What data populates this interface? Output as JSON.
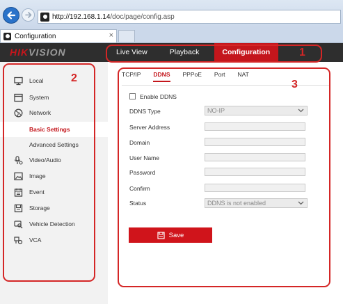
{
  "browser": {
    "url_host": "http://192.168.1.14",
    "url_path": "/doc/page/config.asp",
    "tab_title": "Configuration",
    "tab_close": "×"
  },
  "header": {
    "logo_brand": "HIK",
    "logo_rest": "VISION",
    "nav": [
      {
        "label": "Live View",
        "active": false
      },
      {
        "label": "Playback",
        "active": false
      },
      {
        "label": "Configuration",
        "active": true
      }
    ]
  },
  "sidebar": {
    "items": [
      {
        "label": "Local",
        "icon": "monitor-icon"
      },
      {
        "label": "System",
        "icon": "system-icon"
      },
      {
        "label": "Network",
        "icon": "globe-icon"
      },
      {
        "label": "Basic Settings",
        "sub": true,
        "active": true
      },
      {
        "label": "Advanced Settings",
        "sub": true
      },
      {
        "label": "Video/Audio",
        "icon": "microphone-icon"
      },
      {
        "label": "Image",
        "icon": "image-icon"
      },
      {
        "label": "Event",
        "icon": "calendar-icon"
      },
      {
        "label": "Storage",
        "icon": "storage-icon"
      },
      {
        "label": "Vehicle Detection",
        "icon": "vehicle-search-icon"
      },
      {
        "label": "VCA",
        "icon": "vca-icon"
      }
    ]
  },
  "content": {
    "subtabs": [
      {
        "label": "TCP/IP",
        "active": false
      },
      {
        "label": "DDNS",
        "active": true
      },
      {
        "label": "PPPoE",
        "active": false
      },
      {
        "label": "Port",
        "active": false
      },
      {
        "label": "NAT",
        "active": false
      }
    ],
    "enable_ddns_label": "Enable DDNS",
    "enable_ddns_checked": false,
    "fields": {
      "ddns_type_label": "DDNS Type",
      "ddns_type_value": "NO-IP",
      "server_address_label": "Server Address",
      "domain_label": "Domain",
      "user_name_label": "User Name",
      "password_label": "Password",
      "confirm_label": "Confirm",
      "status_label": "Status",
      "status_value": "DDNS is not enabled"
    },
    "save_label": "Save"
  },
  "annotations": {
    "one": "1",
    "two": "2",
    "three": "3"
  },
  "colors": {
    "accent": "#c4161c",
    "annotation": "#d42626"
  }
}
